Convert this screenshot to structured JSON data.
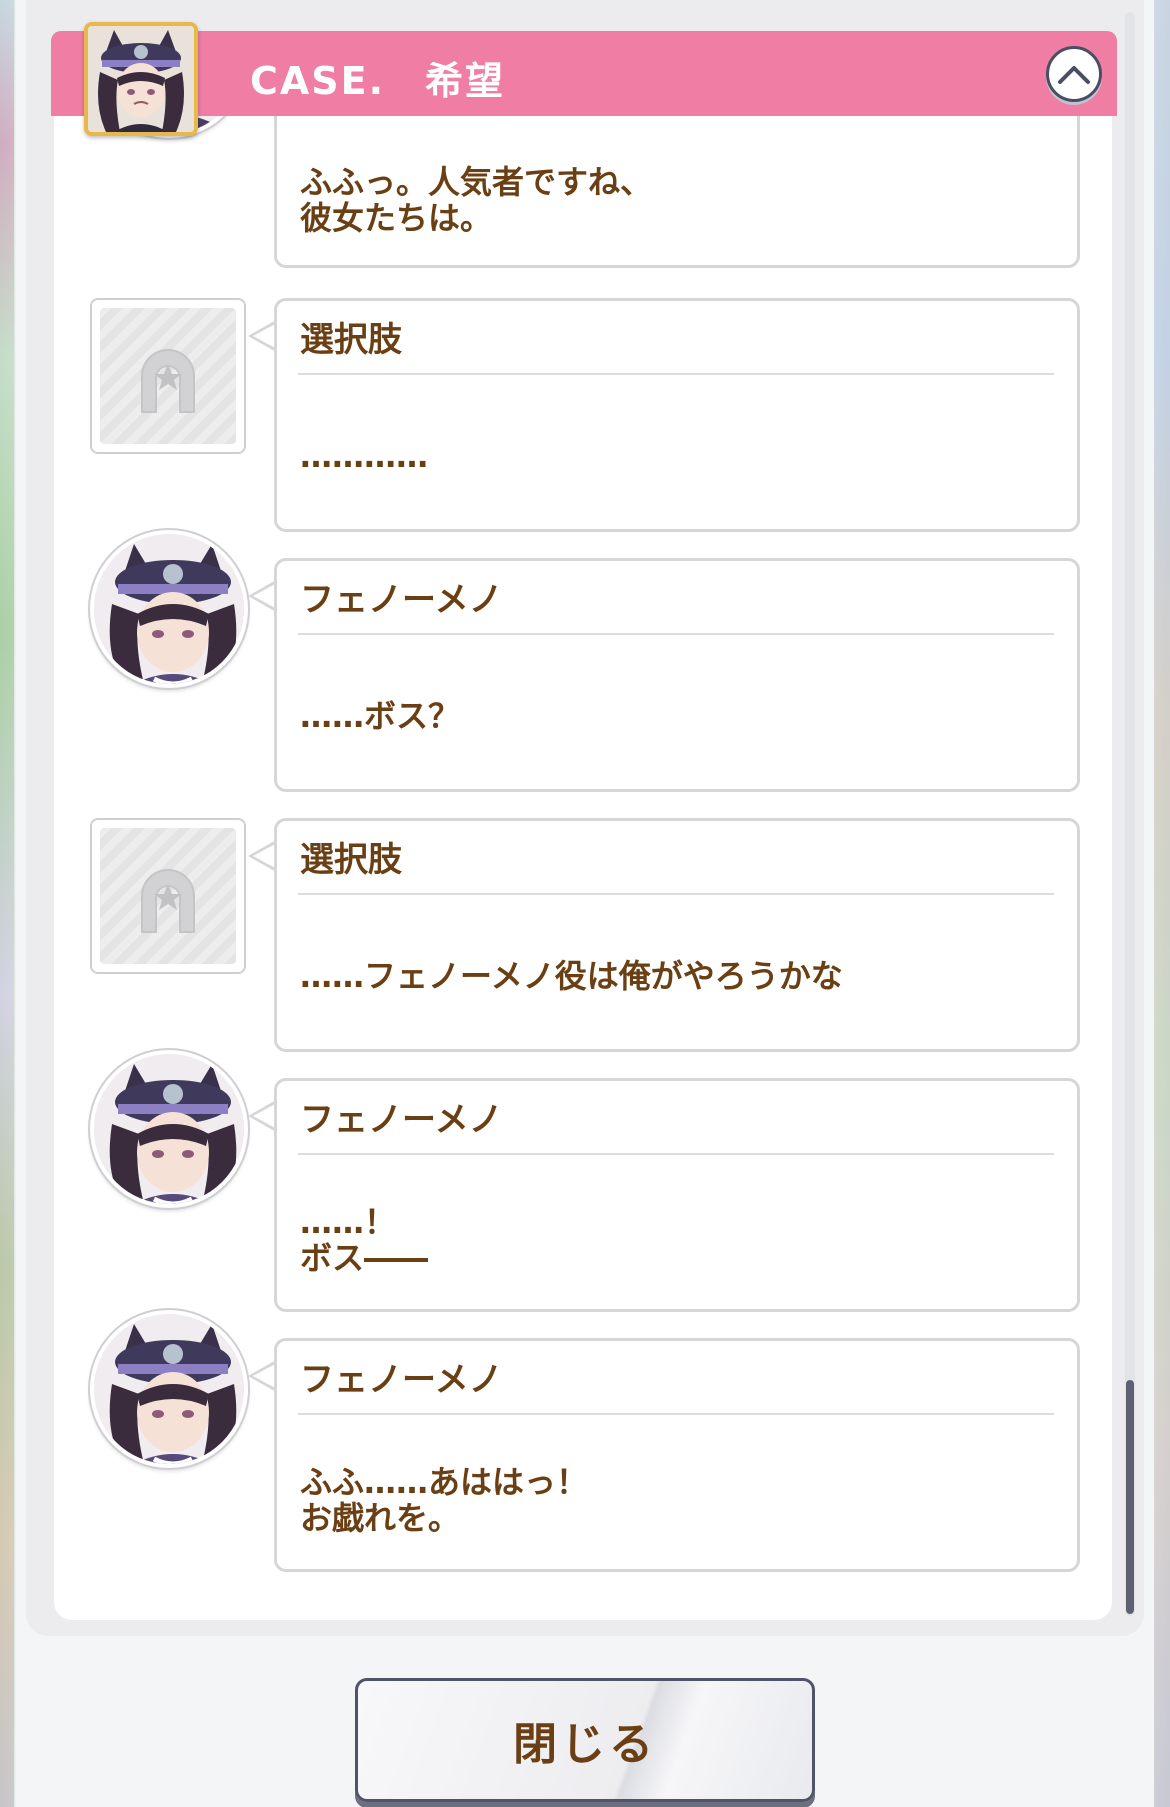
{
  "header": {
    "title": "CASE.　希望"
  },
  "top_partial_entry": {
    "text": "ふふっ。人気者ですね、\n彼女たちは。"
  },
  "entries": [
    {
      "type": "choice",
      "speaker": "選択肢",
      "text": "…………"
    },
    {
      "type": "character",
      "speaker": "フェノーメノ",
      "text": "……ボス？"
    },
    {
      "type": "choice",
      "speaker": "選択肢",
      "text": "……フェノーメノ役は俺がやろうかな"
    },
    {
      "type": "character",
      "speaker": "フェノーメノ",
      "text": "……！\nボス――"
    },
    {
      "type": "character",
      "speaker": "フェノーメノ",
      "text": "ふふ……あははっ！\nお戯れを。"
    }
  ],
  "close_button": {
    "label": "閉じる"
  },
  "colors": {
    "header_pink": "#ef7da4",
    "text_brown": "#6a3f14",
    "bubble_border": "#d6d6d8",
    "avatar_frame_gold": "#e8b94a"
  },
  "icons": {
    "collapse": "chevron-up-icon",
    "choice_placeholder": "horseshoe-star-icon"
  }
}
